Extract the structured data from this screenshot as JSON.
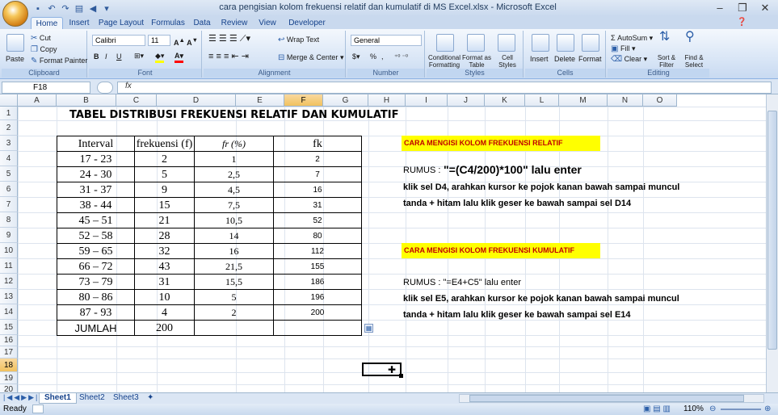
{
  "window": {
    "title": "cara pengisian kolom frekuensi relatif dan kumulatif di MS Excel.xlsx - Microsoft Excel",
    "controls": [
      "–",
      "❐",
      "✕"
    ]
  },
  "ribbon_tabs": [
    "Home",
    "Insert",
    "Page Layout",
    "Formulas",
    "Data",
    "Review",
    "View",
    "Developer"
  ],
  "ribbon": {
    "clipboard": {
      "label": "Clipboard",
      "paste": "Paste",
      "cut": "Cut",
      "copy": "Copy",
      "format_painter": "Format Painter"
    },
    "font": {
      "label": "Font",
      "name": "Calibri",
      "size": "11",
      "bold": "B",
      "italic": "I",
      "underline": "U"
    },
    "alignment": {
      "label": "Alignment",
      "wrap": "Wrap Text",
      "merge": "Merge & Center"
    },
    "number": {
      "label": "Number",
      "format": "General",
      "percent": "%",
      "comma": ","
    },
    "styles": {
      "label": "Styles",
      "conditional": "Conditional Formatting",
      "format_table": "Format as Table",
      "cell_styles": "Cell Styles"
    },
    "cells": {
      "label": "Cells",
      "insert": "Insert",
      "delete": "Delete",
      "format": "Format"
    },
    "editing": {
      "label": "Editing",
      "autosum": "AutoSum",
      "fill": "Fill",
      "clear": "Clear",
      "sort": "Sort & Filter",
      "find": "Find & Select"
    }
  },
  "formula_bar": {
    "name_box": "F18",
    "fx": "fx",
    "content": ""
  },
  "columns": [
    "A",
    "B",
    "C",
    "D",
    "E",
    "F",
    "G",
    "H",
    "I",
    "J",
    "K",
    "L",
    "M",
    "N",
    "O"
  ],
  "rows": [
    "1",
    "2",
    "3",
    "4",
    "5",
    "6",
    "7",
    "8",
    "9",
    "10",
    "11",
    "12",
    "13",
    "14",
    "15",
    "16",
    "17",
    "18",
    "19",
    "20"
  ],
  "sheet": {
    "title": "TABEL DISTRIBUSI FREKUENSI RELATIF DAN KUMULATIF",
    "headers": [
      "Interval",
      "frekuensi (f)",
      "fr (%)",
      "fk"
    ],
    "table": [
      [
        "17 - 23",
        "2",
        "1",
        "2"
      ],
      [
        "24 - 30",
        "5",
        "2,5",
        "7"
      ],
      [
        "31 - 37",
        "9",
        "4,5",
        "16"
      ],
      [
        "38 - 44",
        "15",
        "7,5",
        "31"
      ],
      [
        "45 – 51",
        "21",
        "10,5",
        "52"
      ],
      [
        "52 – 58",
        "28",
        "14",
        "80"
      ],
      [
        "59 – 65",
        "32",
        "16",
        "112"
      ],
      [
        "66 – 72",
        "43",
        "21,5",
        "155"
      ],
      [
        "73 – 79",
        "31",
        "15,5",
        "186"
      ],
      [
        "80 – 86",
        "10",
        "5",
        "196"
      ],
      [
        "87 - 93",
        "4",
        "2",
        "200"
      ]
    ],
    "total_label": "JUMLAH",
    "total_value": "200",
    "notes": {
      "relatif_heading": "CARA MENGISI KOLOM FREKUENSI RELATIF",
      "relatif_rumus_label": "RUMUS :",
      "relatif_rumus": "\"=(C4/200)*100\" lalu enter",
      "relatif_line1": "klik sel D4, arahkan kursor ke pojok kanan bawah sampai muncul",
      "relatif_line2": "tanda + hitam lalu klik geser ke bawah sampai sel D14",
      "kumulatif_heading": "CARA MENGISI KOLOM FREKUENSI KUMULATIF",
      "kumulatif_rumus": "RUMUS : \"=E4+C5\" lalu enter",
      "kumulatif_line1": "klik sel E5, arahkan kursor ke pojok kanan bawah sampai muncul",
      "kumulatif_line2": "tanda + hitam lalu klik geser ke bawah sampai sel E14"
    },
    "highlight_color": "#ffff00"
  },
  "sheet_tabs": [
    "Sheet1",
    "Sheet2",
    "Sheet3"
  ],
  "status": {
    "ready": "Ready",
    "zoom": "110%"
  }
}
